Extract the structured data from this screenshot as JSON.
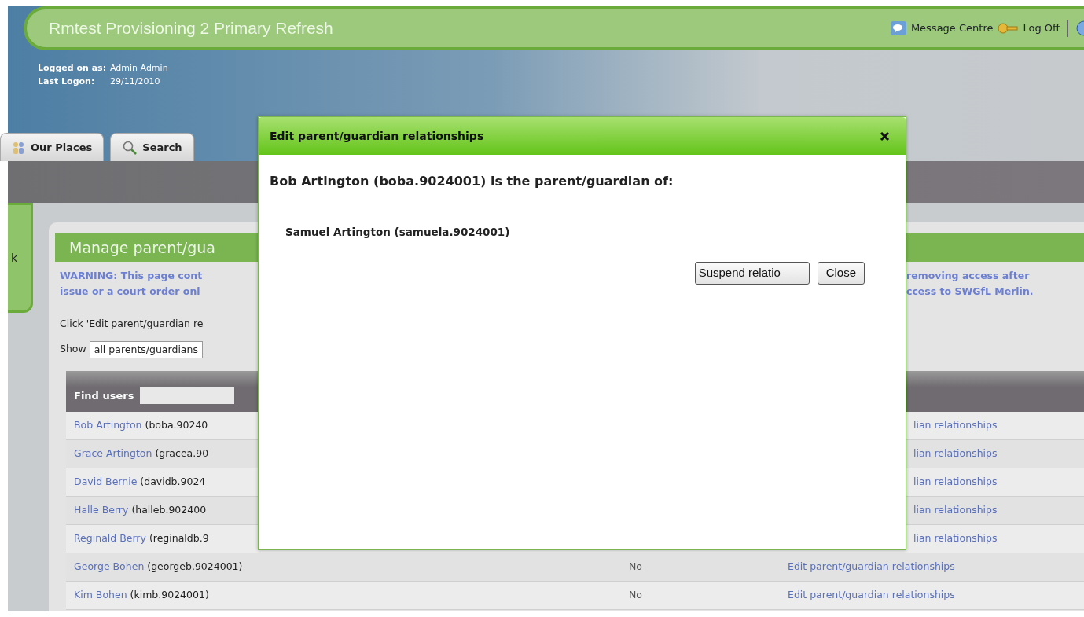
{
  "header": {
    "title": "Rmtest Provisioning 2 Primary Refresh",
    "links": [
      {
        "kind": "message",
        "label": "Message Centre"
      },
      {
        "kind": "logoff",
        "label": "Log Off"
      }
    ],
    "logon": [
      {
        "label": "Logged on as:",
        "value": "Admin Admin"
      },
      {
        "label": "Last Logon:",
        "value": "29/11/2010"
      }
    ]
  },
  "tabs": [
    {
      "kind": "people",
      "label": "Our Places",
      "selected": false
    },
    {
      "kind": "search",
      "label": "Search",
      "selected": false
    }
  ],
  "side_tab": {
    "label": "k"
  },
  "manage_panel": {
    "title": "Manage parent/gua",
    "warning_left": [
      "WARNING: This page cont",
      "issue or a court order onl"
    ],
    "warning_right": [
      "removing access after",
      "ccess to SWGfL Merlin."
    ],
    "instruction": "Click 'Edit parent/guardian re",
    "show_label": "Show",
    "show_value": "all parents/guardians",
    "find_users_label": "Find users"
  },
  "table": {
    "rows": [
      {
        "kind": "split",
        "name": "Bob Artington",
        "username": "(boba.90240",
        "action": "lian relationships"
      },
      {
        "kind": "split",
        "name": "Grace Artington",
        "username": "(gracea.90",
        "action": "lian relationships"
      },
      {
        "kind": "split",
        "name": "David Bernie",
        "username": "(davidb.9024",
        "action": "lian relationships"
      },
      {
        "kind": "split",
        "name": "Halle Berry",
        "username": "(halleb.902400",
        "action": "lian relationships"
      },
      {
        "kind": "split",
        "name": "Reginald Berry",
        "username": "(reginaldb.9",
        "action": "lian relationships"
      },
      {
        "kind": "full",
        "name": "George Bohen",
        "username": "(georgeb.9024001)",
        "column_2": "No",
        "action": "Edit parent/guardian relationships"
      },
      {
        "kind": "full",
        "name": "Kim Bohen",
        "username": "(kimb.9024001)",
        "column_2": "No",
        "action": "Edit parent/guardian relationships"
      }
    ]
  },
  "dialog": {
    "title": "Edit parent/guardian relationships",
    "heading": "Bob Artington (boba.9024001) is the parent/guardian of:",
    "children": [
      "Samuel Artington (samuela.9024001)"
    ],
    "buttons": [
      "Suspend relatio",
      "Close"
    ]
  }
}
